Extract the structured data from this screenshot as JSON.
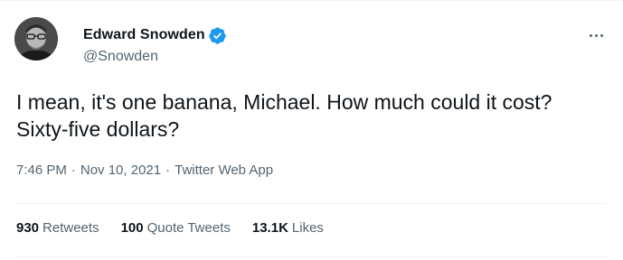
{
  "author": {
    "display_name": "Edward Snowden",
    "handle": "@Snowden",
    "verified_badge_color": "#1d9bf0"
  },
  "tweet": {
    "text": "I mean, it's one banana, Michael. How much could it cost? Sixty-five dollars?",
    "time": "7:46 PM",
    "separator": "·",
    "date": "Nov 10, 2021",
    "source": "Twitter Web App"
  },
  "stats": [
    {
      "value": "930",
      "label": "Retweets"
    },
    {
      "value": "100",
      "label": "Quote Tweets"
    },
    {
      "value": "13.1K",
      "label": "Likes"
    }
  ],
  "icons": {
    "more": "more-icon",
    "verified": "verified-badge-icon"
  }
}
